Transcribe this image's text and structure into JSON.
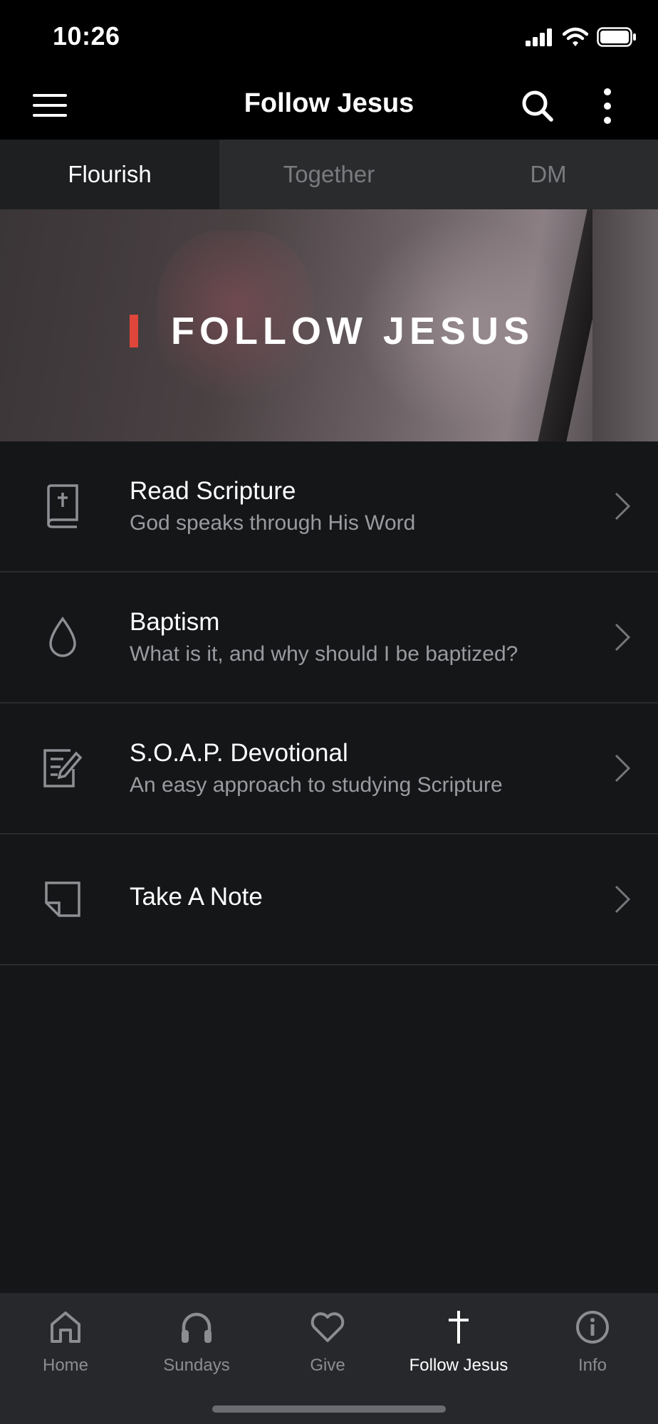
{
  "status_bar": {
    "time": "10:26"
  },
  "app_bar": {
    "title": "Follow Jesus"
  },
  "tabs": [
    {
      "label": "Flourish",
      "active": true
    },
    {
      "label": "Together",
      "active": false
    },
    {
      "label": "DM",
      "active": false
    }
  ],
  "hero": {
    "title": "FOLLOW JESUS",
    "accent_color": "#e0463a"
  },
  "items": [
    {
      "title": "Read Scripture",
      "subtitle": "God speaks through His Word",
      "icon": "bible-icon"
    },
    {
      "title": "Baptism",
      "subtitle": "What is it, and why should I be baptized?",
      "icon": "water-drop-icon"
    },
    {
      "title": "S.O.A.P. Devotional",
      "subtitle": "An easy approach to studying Scripture",
      "icon": "edit-document-icon"
    },
    {
      "title": "Take A Note",
      "subtitle": "",
      "icon": "note-icon"
    }
  ],
  "bottom_nav": [
    {
      "label": "Home",
      "icon": "home-icon",
      "active": false
    },
    {
      "label": "Sundays",
      "icon": "headphones-icon",
      "active": false
    },
    {
      "label": "Give",
      "icon": "heart-icon",
      "active": false
    },
    {
      "label": "Follow Jesus",
      "icon": "cross-icon",
      "active": true
    },
    {
      "label": "Info",
      "icon": "info-icon",
      "active": false
    }
  ]
}
